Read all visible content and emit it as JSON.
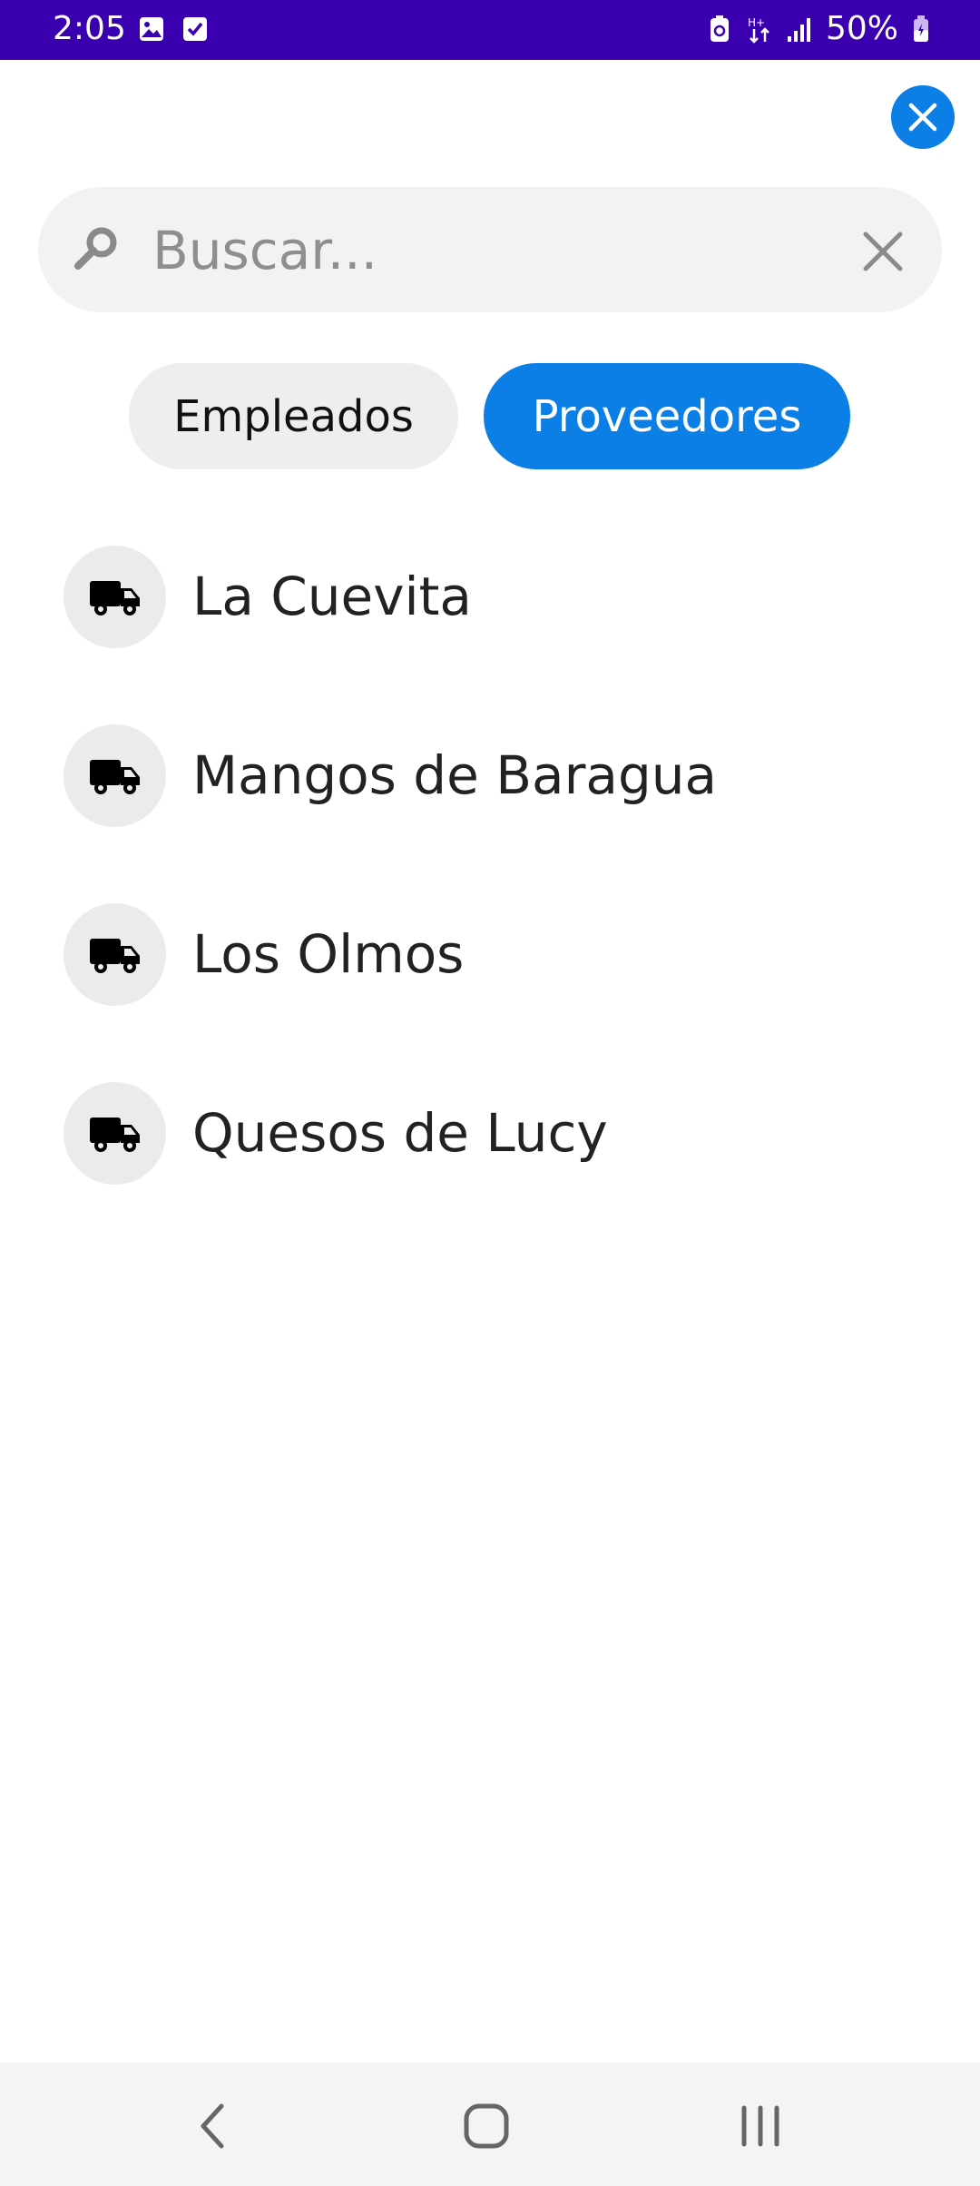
{
  "status_bar": {
    "time": "2:05",
    "battery": "50%",
    "icons_left": [
      "gallery-icon",
      "checkbox-icon"
    ],
    "icons_right": [
      "battery-saver-icon",
      "data-arrows-icon",
      "signal-icon",
      "battery-icon"
    ],
    "background": "#3a00b0"
  },
  "search": {
    "placeholder": "Buscar..."
  },
  "tabs": [
    {
      "label": "Empleados",
      "active": false
    },
    {
      "label": "Proveedores",
      "active": true
    }
  ],
  "suppliers": [
    {
      "name": "La Cuevita",
      "icon": "truck-icon"
    },
    {
      "name": "Mangos de Baragua",
      "icon": "truck-icon"
    },
    {
      "name": "Los Olmos",
      "icon": "truck-icon"
    },
    {
      "name": "Quesos de Lucy",
      "icon": "truck-icon"
    }
  ],
  "colors": {
    "accent": "#0b7fe6",
    "chip_inactive": "#eeeeee",
    "avatar_bg": "#ebebeb"
  },
  "nav": {
    "buttons": [
      "back-icon",
      "home-icon",
      "recents-icon"
    ]
  }
}
